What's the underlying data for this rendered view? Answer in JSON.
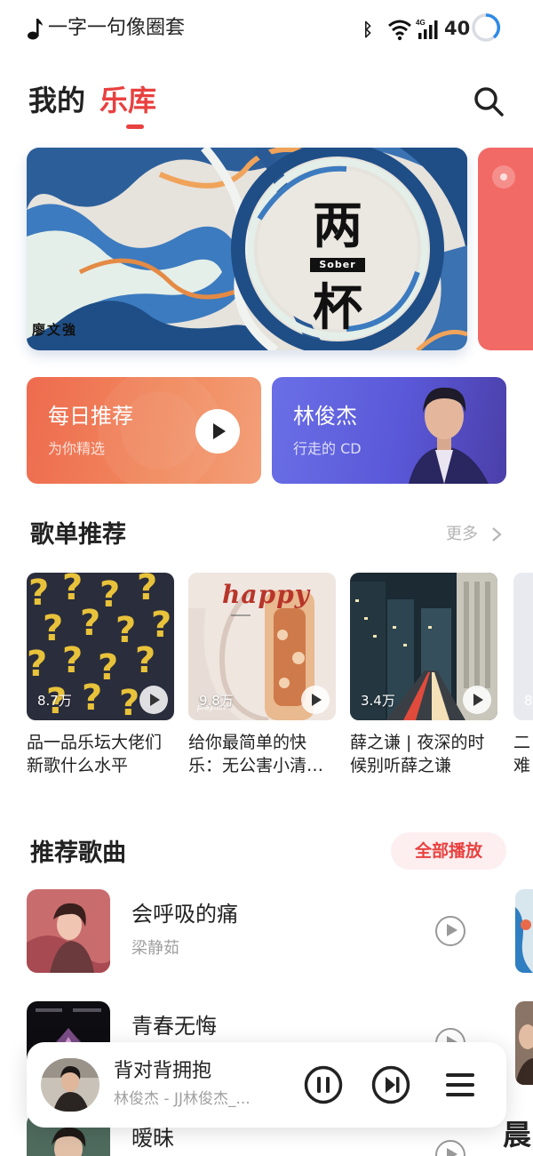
{
  "status_bar": {
    "now_playing": "一字一句像圈套",
    "battery": "40",
    "icons": [
      "music-note-icon",
      "bluetooth-icon",
      "wifi-icon",
      "signal-4g-icon",
      "battery-ring-icon"
    ]
  },
  "header": {
    "tab_mine": "我的",
    "tab_library": "乐库",
    "search_icon": "search-icon"
  },
  "banner": {
    "char_top": "两",
    "tag": "Sober",
    "char_bottom": "杯",
    "artist": "廖文強"
  },
  "cards": {
    "daily": {
      "title": "每日推荐",
      "subtitle": "为你精选"
    },
    "artist": {
      "title": "林俊杰",
      "subtitle": "行走的 CD"
    }
  },
  "playlists": {
    "title": "歌单推荐",
    "more": "更多",
    "items": [
      {
        "count": "8.7万",
        "name": "品一品乐坛大佬们新歌什么水平"
      },
      {
        "count": "9.8万",
        "name": "给你最简单的快乐：无公害小清…",
        "cover_text": "happy",
        "cover_tag": "playlist"
      },
      {
        "count": "3.4万",
        "name": "薛之谦 | 夜深的时候别听薛之谦"
      }
    ],
    "partial_count": "8",
    "partial_name": "二难"
  },
  "songs": {
    "title": "推荐歌曲",
    "play_all": "全部播放",
    "items": [
      {
        "title": "会呼吸的痛",
        "artist": "梁静茹"
      },
      {
        "title": "青春无悔",
        "artist": ""
      },
      {
        "title": "暧昧",
        "artist": ""
      }
    ],
    "partial_right_text": "晨"
  },
  "mini_player": {
    "title": "背对背拥抱",
    "subtitle": "林俊杰 - JJ林俊杰_...",
    "icons": [
      "pause-icon",
      "skip-next-icon",
      "playlist-menu-icon"
    ]
  },
  "colors": {
    "accent": "#e8413f",
    "daily_card": "#ee6b4f",
    "artist_card": "#5a58d8",
    "play_all_bg": "#fdeef0"
  }
}
